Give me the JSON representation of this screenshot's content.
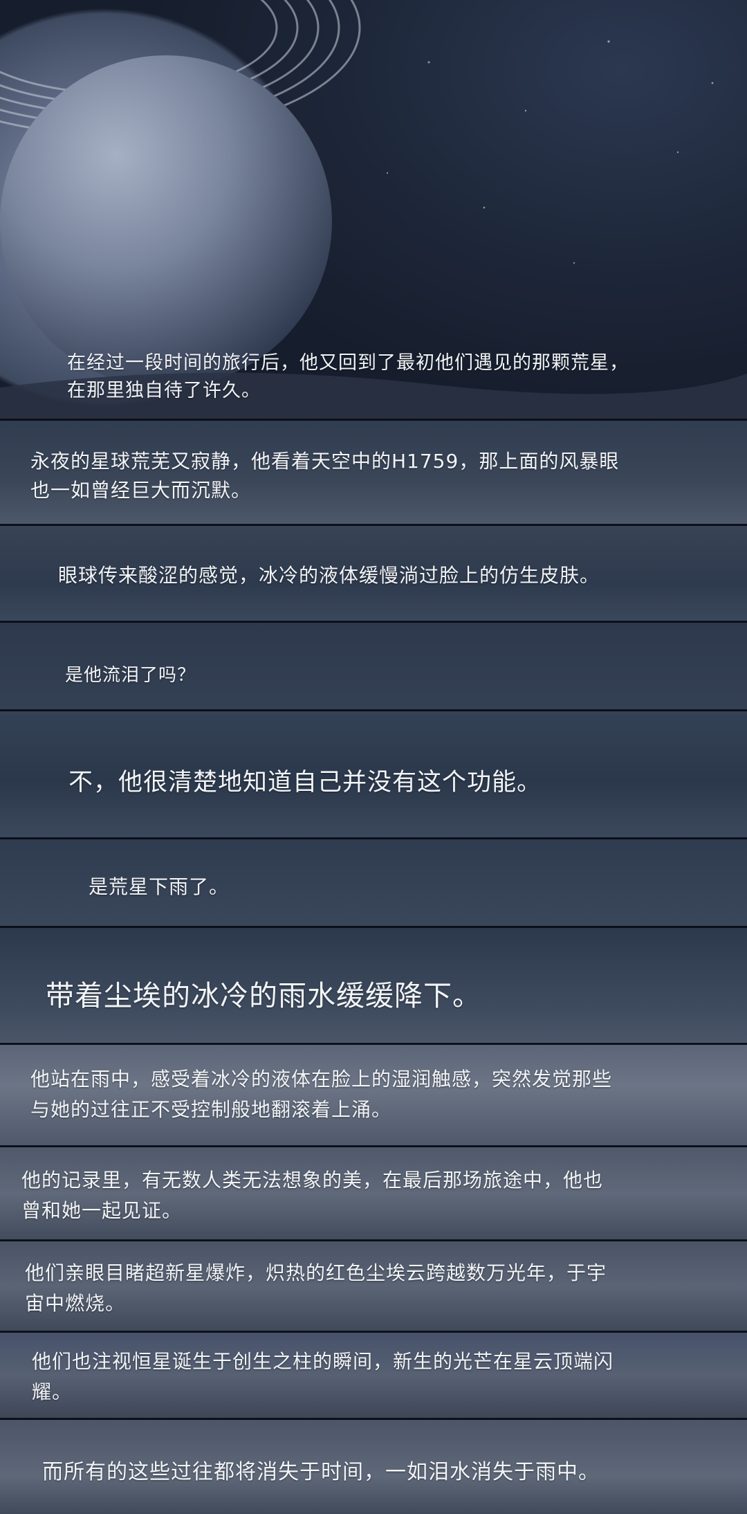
{
  "captions": [
    "在经过一段时间的旅行后，他又回到了最初他们遇见的那颗荒星，\n在那里独自待了许久。",
    "永夜的星球荒芜又寂静，他看着天空中的H1759，那上面的风暴眼\n也一如曾经巨大而沉默。",
    "眼球传来酸涩的感觉，冰冷的液体缓慢淌过脸上的仿生皮肤。",
    "是他流泪了吗？",
    "不，他很清楚地知道自己并没有这个功能。",
    "是荒星下雨了。",
    "带着尘埃的冰冷的雨水缓缓降下。",
    "他站在雨中，感受着冰冷的液体在脸上的湿润触感，突然发觉那些\n与她的过往正不受控制般地翻滚着上涌。",
    "他的记录里，有无数人类无法想象的美，在最后那场旅途中，他也\n曾和她一起见证。",
    "他们亲眼目睹超新星爆炸，炽热的红色尘埃云跨越数万光年，于宇\n宙中燃烧。",
    "他们也注视恒星诞生于创生之柱的瞬间，新生的光芒在星云顶端闪\n耀。",
    "而所有的这些过往都将消失于时间，一如泪水消失于雨中。"
  ]
}
